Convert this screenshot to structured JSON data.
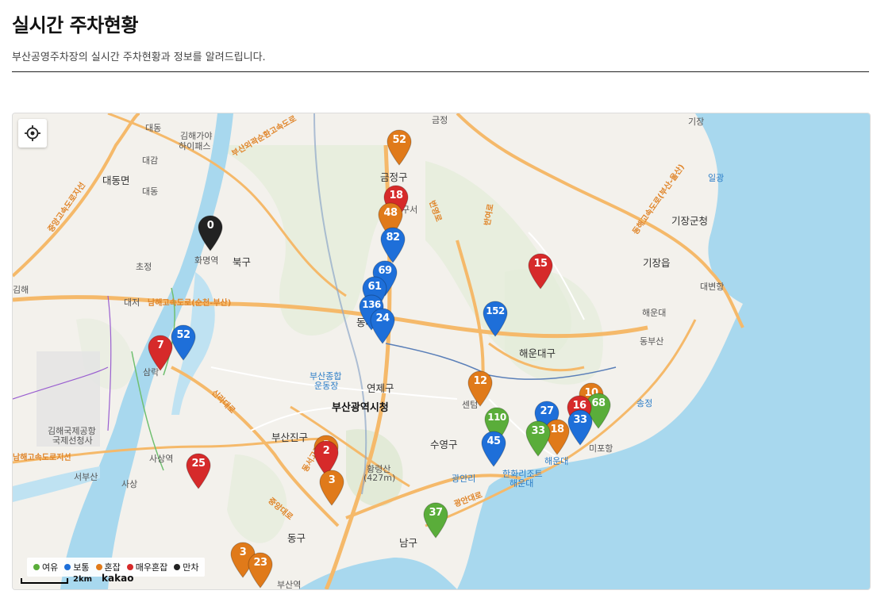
{
  "header": {
    "title": "실시간 주차현황",
    "description": "부산공영주차장의 실시간 주차현황과 정보를 알려드립니다."
  },
  "colors": {
    "여유": "#5aad3a",
    "보통": "#1e6fd9",
    "혼잡": "#e07a1a",
    "매우혼잡": "#d62a2a",
    "만차": "#222222",
    "sea": "#a8d8ee",
    "river": "#a8d8ee"
  },
  "legend": [
    {
      "label": "여유",
      "status": "여유"
    },
    {
      "label": "보통",
      "status": "보통"
    },
    {
      "label": "혼잡",
      "status": "혼잡"
    },
    {
      "label": "매우혼잡",
      "status": "매우혼잡"
    },
    {
      "label": "만차",
      "status": "만차"
    }
  ],
  "scale": {
    "label": "2km",
    "brand": "kakao"
  },
  "locate_button": {
    "icon": "crosshair-icon"
  },
  "places": [
    {
      "text": "대동"
    },
    {
      "text": "대감"
    },
    {
      "text": "김해가야"
    },
    {
      "text": "하이패스"
    },
    {
      "text": "대동"
    },
    {
      "text": "대동면"
    },
    {
      "text": "금정구"
    },
    {
      "text": "구서"
    },
    {
      "text": "북구"
    },
    {
      "text": "화명역"
    },
    {
      "text": "초정"
    },
    {
      "text": "대저"
    },
    {
      "text": "김해"
    },
    {
      "text": "동래"
    },
    {
      "text": "해운대구"
    },
    {
      "text": "기장군청"
    },
    {
      "text": "기장읍"
    },
    {
      "text": "대변항"
    },
    {
      "text": "해운대"
    },
    {
      "text": "동부산"
    },
    {
      "text": "일광"
    },
    {
      "text": "연제구"
    },
    {
      "text": "부산광역시청"
    },
    {
      "text": "부산종합"
    },
    {
      "text": "운동장"
    },
    {
      "text": "부산진구"
    },
    {
      "text": "수영구"
    },
    {
      "text": "황령산"
    },
    {
      "text": "(427m)"
    },
    {
      "text": "광안리"
    },
    {
      "text": "한화리조트"
    },
    {
      "text": "해운대"
    },
    {
      "text": "해운대"
    },
    {
      "text": "미포항"
    },
    {
      "text": "센텀"
    },
    {
      "text": "송정"
    },
    {
      "text": "김해국제공항"
    },
    {
      "text": "국제선청사"
    },
    {
      "text": "서부산"
    },
    {
      "text": "사상"
    },
    {
      "text": "사상역"
    },
    {
      "text": "삼락"
    },
    {
      "text": "동구"
    },
    {
      "text": "남구"
    },
    {
      "text": "부산역"
    },
    {
      "text": "기장"
    },
    {
      "text": "금정"
    },
    {
      "text": "기장읍"
    }
  ],
  "roads": [
    {
      "text": "남해고속도로(순천-부산)"
    },
    {
      "text": "중앙고속도로지선"
    },
    {
      "text": "부산외곽순환고속도로"
    },
    {
      "text": "번영로"
    },
    {
      "text": "동해고속도로(부산-울산)"
    },
    {
      "text": "광안대로"
    },
    {
      "text": "신라대로"
    },
    {
      "text": "동서고가로"
    },
    {
      "text": "중앙대로"
    },
    {
      "text": "남해고속도로지선"
    },
    {
      "text": "반여로"
    }
  ],
  "markers": [
    {
      "value": "52",
      "status": "혼잡"
    },
    {
      "value": "18",
      "status": "매우혼잡"
    },
    {
      "value": "48",
      "status": "혼잡"
    },
    {
      "value": "0",
      "status": "만차"
    },
    {
      "value": "82",
      "status": "보통"
    },
    {
      "value": "69",
      "status": "보통"
    },
    {
      "value": "61",
      "status": "보통"
    },
    {
      "value": "136",
      "status": "보통"
    },
    {
      "value": "24",
      "status": "보통"
    },
    {
      "value": "15",
      "status": "매우혼잡"
    },
    {
      "value": "152",
      "status": "보통"
    },
    {
      "value": "52",
      "status": "보통"
    },
    {
      "value": "7",
      "status": "매우혼잡"
    },
    {
      "value": "12",
      "status": "혼잡"
    },
    {
      "value": "10",
      "status": "혼잡"
    },
    {
      "value": "68",
      "status": "여유"
    },
    {
      "value": "16",
      "status": "매우혼잡"
    },
    {
      "value": "27",
      "status": "보통"
    },
    {
      "value": "110",
      "status": "여유"
    },
    {
      "value": "33",
      "status": "보통"
    },
    {
      "value": "18",
      "status": "혼잡"
    },
    {
      "value": "33",
      "status": "여유"
    },
    {
      "value": "45",
      "status": "보통"
    },
    {
      "value": "3",
      "status": "혼잡"
    },
    {
      "value": "2",
      "status": "매우혼잡"
    },
    {
      "value": "3",
      "status": "혼잡"
    },
    {
      "value": "25",
      "status": "매우혼잡"
    },
    {
      "value": "37",
      "status": "여유"
    },
    {
      "value": "3",
      "status": "혼잡"
    },
    {
      "value": "23",
      "status": "혼잡"
    }
  ]
}
